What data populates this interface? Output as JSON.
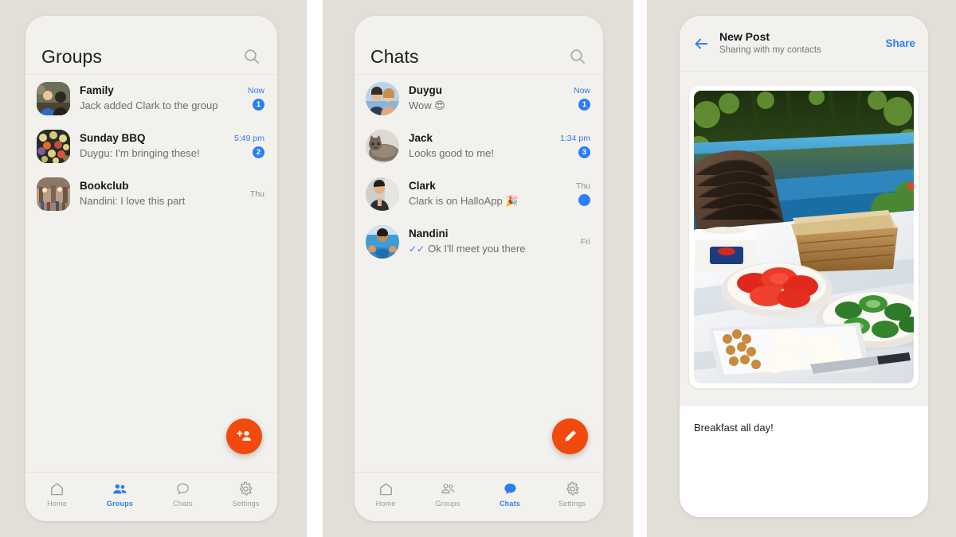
{
  "app": {
    "name": "HalloApp",
    "accent_blue": "#2d7ff0",
    "accent_orange": "#f2490c",
    "panel_bg": "#e2ded8",
    "phone_bg": "#f3f1ed"
  },
  "screen_groups": {
    "title": "Groups",
    "search_icon": "search-icon",
    "fab_icon": "add-group-icon",
    "rows": [
      {
        "avatar": "group-family-photo",
        "name": "Family",
        "preview": "Jack added Clark to the group",
        "time": "Now",
        "time_unread": true,
        "badge": "1",
        "badge_type": "count"
      },
      {
        "avatar": "group-bbq-photo",
        "name": "Sunday BBQ",
        "preview": "Duygu: I'm bringing these!",
        "time": "5:49 pm",
        "time_unread": true,
        "badge": "2",
        "badge_type": "count"
      },
      {
        "avatar": "group-bookclub-photo",
        "name": "Bookclub",
        "preview": "Nandini: I love this part",
        "time": "Thu",
        "time_unread": false,
        "badge": "",
        "badge_type": "none"
      }
    ],
    "tabs": [
      {
        "label": "Home",
        "icon": "home-icon",
        "active": false
      },
      {
        "label": "Groups",
        "icon": "groups-icon",
        "active": true
      },
      {
        "label": "Chats",
        "icon": "chats-icon",
        "active": false
      },
      {
        "label": "Settings",
        "icon": "gear-icon",
        "active": false
      }
    ]
  },
  "screen_chats": {
    "title": "Chats",
    "search_icon": "search-icon",
    "fab_icon": "compose-pencil-icon",
    "rows": [
      {
        "avatar": "contact-duygu-photo",
        "name": "Duygu",
        "preview": "Wow 😍",
        "tick": false,
        "time": "Now",
        "time_unread": true,
        "badge": "1",
        "badge_type": "count"
      },
      {
        "avatar": "contact-jack-photo",
        "name": "Jack",
        "preview": "Looks good to me!",
        "tick": false,
        "time": "1:34 pm",
        "time_unread": true,
        "badge": "3",
        "badge_type": "count"
      },
      {
        "avatar": "contact-clark-photo",
        "name": "Clark",
        "preview": "Clark is on HalloApp 🎉",
        "tick": false,
        "time": "Thu",
        "time_unread": false,
        "badge": "",
        "badge_type": "dot"
      },
      {
        "avatar": "contact-nandini-photo",
        "name": "Nandini",
        "preview": "Ok I'll meet you there",
        "tick": true,
        "time": "Fri",
        "time_unread": false,
        "badge": "",
        "badge_type": "none"
      }
    ],
    "tabs": [
      {
        "label": "Home",
        "icon": "home-icon",
        "active": false
      },
      {
        "label": "Groups",
        "icon": "groups-icon",
        "active": false
      },
      {
        "label": "Chats",
        "icon": "chats-icon",
        "active": true
      },
      {
        "label": "Settings",
        "icon": "gear-icon",
        "active": false
      }
    ]
  },
  "screen_new_post": {
    "back_icon": "back-arrow-icon",
    "title": "New Post",
    "subtitle": "Sharing with my contacts",
    "share_label": "Share",
    "photo_name": "breakfast-poolside-photo",
    "caption": "Breakfast all day!"
  }
}
